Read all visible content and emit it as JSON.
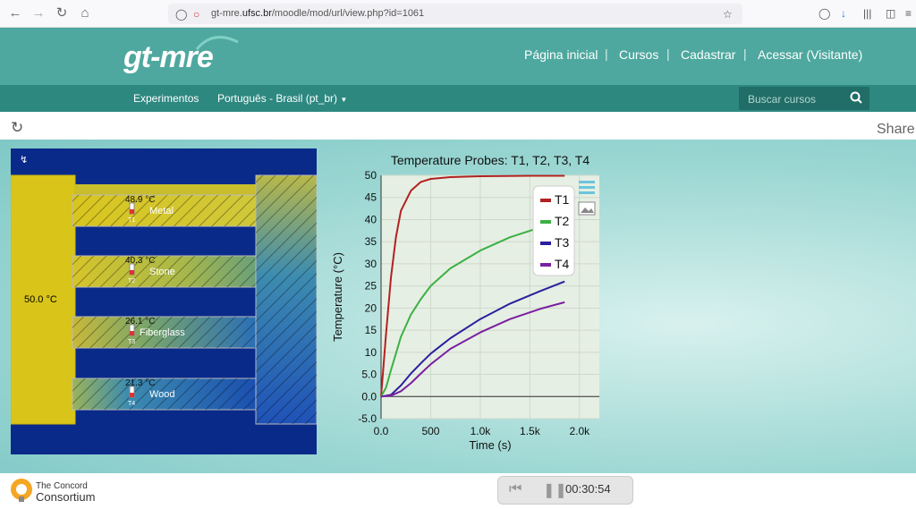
{
  "browser": {
    "url_prefix": "gt-mre.",
    "url_domain": "ufsc.br",
    "url_rest": "/moodle/mod/url/view.php?id=1061"
  },
  "site": {
    "logo": "gt-mre",
    "menu": [
      "Página inicial",
      "Cursos",
      "Cadastrar",
      "Acessar (Visitante)"
    ],
    "subnav": [
      "Experimentos",
      "Português - Brasil (pt_br)"
    ],
    "search_placeholder": "Buscar cursos"
  },
  "toolbar": {
    "share": "Share"
  },
  "simulation": {
    "source_temp": "50.0 °C",
    "bars": [
      {
        "name": "Metal",
        "temp": "48.9 °C",
        "probe": "T1"
      },
      {
        "name": "Stone",
        "temp": "40.3 °C",
        "probe": "T2"
      },
      {
        "name": "Fiberglass",
        "temp": "26.1 °C",
        "probe": "T3"
      },
      {
        "name": "Wood",
        "temp": "21.3 °C",
        "probe": "T4"
      }
    ]
  },
  "chart_data": {
    "type": "line",
    "title": "Temperature Probes: T1, T2, T3, T4",
    "xlabel": "Time (s)",
    "ylabel": "Temperature (°C)",
    "xlim": [
      0,
      2200
    ],
    "ylim": [
      -5,
      50
    ],
    "x_ticks": [
      "0.0",
      "500",
      "1.0k",
      "1.5k",
      "2.0k"
    ],
    "y_ticks": [
      "50",
      "45",
      "40",
      "35",
      "30",
      "25",
      "20",
      "15",
      "10",
      "5.0",
      "0.0",
      "-5.0"
    ],
    "legend_position": "top-right",
    "series": [
      {
        "name": "T1",
        "color": "#b22222",
        "x": [
          0,
          50,
          100,
          150,
          200,
          300,
          400,
          500,
          700,
          1000,
          1500,
          1850
        ],
        "y": [
          0,
          14,
          27,
          36,
          42,
          46.5,
          48.5,
          49.2,
          49.6,
          49.8,
          49.9,
          49.9
        ]
      },
      {
        "name": "T2",
        "color": "#3cb044",
        "x": [
          0,
          50,
          100,
          200,
          300,
          400,
          500,
          700,
          1000,
          1300,
          1600,
          1850
        ],
        "y": [
          0,
          2,
          6,
          13.5,
          18.5,
          22,
          25,
          29,
          33,
          36,
          38.2,
          39.5
        ]
      },
      {
        "name": "T3",
        "color": "#2a1f9e",
        "x": [
          0,
          100,
          200,
          300,
          400,
          500,
          700,
          1000,
          1300,
          1600,
          1850
        ],
        "y": [
          0,
          0.4,
          2.5,
          5.2,
          7.5,
          9.7,
          13.2,
          17.5,
          21,
          23.8,
          26
        ]
      },
      {
        "name": "T4",
        "color": "#7b1fa2",
        "x": [
          0,
          100,
          200,
          300,
          400,
          500,
          700,
          1000,
          1300,
          1600,
          1850
        ],
        "y": [
          0,
          0.2,
          1.2,
          3,
          5.2,
          7.3,
          10.8,
          14.5,
          17.5,
          19.8,
          21.3
        ]
      }
    ]
  },
  "player": {
    "time": "00:30:54"
  },
  "footer": {
    "brand_line1": "The Concord",
    "brand_line2": "Consortium"
  }
}
